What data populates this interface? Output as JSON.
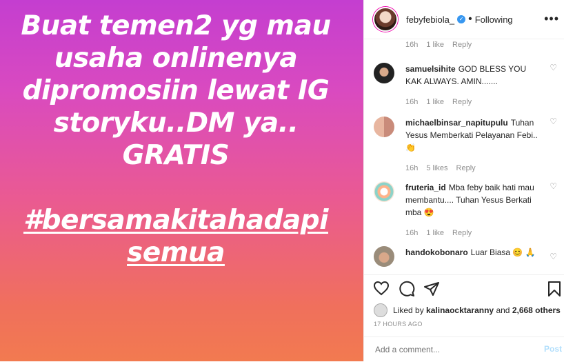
{
  "story": {
    "lines": [
      "Buat temen2 yg mau",
      "usaha onlinenya",
      "dipromosiin lewat IG",
      "storyku..DM ya..",
      "GRATIS"
    ],
    "hashtag_lines": [
      "#bersamakitahadapi",
      "semua"
    ]
  },
  "header": {
    "username": "febyfebiola_",
    "separator": "•",
    "following": "Following",
    "more": "•••"
  },
  "top_meta": {
    "time": "16h",
    "likes": "1 like",
    "reply": "Reply"
  },
  "comments": [
    {
      "user": "samuelsihite",
      "text": "GOD BLESS YOU KAK ALWAYS. AMIN.......",
      "time": "16h",
      "likes": "1 like",
      "reply": "Reply"
    },
    {
      "user": "michaelbinsar_napitupulu",
      "text": "Tuhan Yesus Memberkati Pelayanan Febi..👏",
      "time": "16h",
      "likes": "5 likes",
      "reply": "Reply"
    },
    {
      "user": "fruteria_id",
      "text": "Mba feby baik hati mau membantu.... Tuhan Yesus Berkati mba 😍",
      "time": "16h",
      "likes": "1 like",
      "reply": "Reply"
    },
    {
      "user": "handokobonaro",
      "text": "Luar Biasa 😊 🙏",
      "time": "",
      "likes": "",
      "reply": ""
    }
  ],
  "likes": {
    "prefix": "Liked by ",
    "user": "kalinaocktaranny",
    "mid": " and ",
    "count": "2,668 others"
  },
  "time_ago": "17 HOURS AGO",
  "add_comment": {
    "placeholder": "Add a comment...",
    "post": "Post"
  }
}
